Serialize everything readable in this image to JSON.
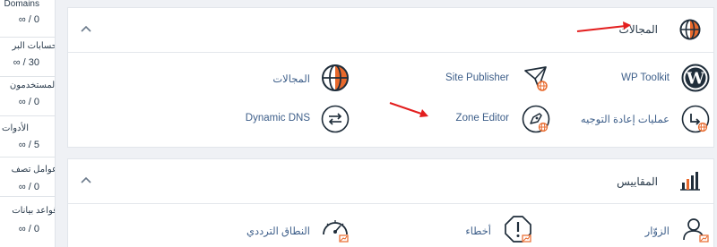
{
  "sidebar": {
    "stats": [
      {
        "label": "Domains",
        "value": "∞ / 0"
      },
      {
        "label": "حسابات البر",
        "value": "∞ / 30"
      },
      {
        "label": "المستخدمون",
        "value": "∞ / 0"
      },
      {
        "label": "الأدوات",
        "value": "∞ / 5"
      },
      {
        "label": "عوامل تصف",
        "value": "∞ / 0"
      },
      {
        "label": "قواعد بيانات",
        "value": "∞ / 0"
      }
    ]
  },
  "domains_panel": {
    "title": "المجالات",
    "items": [
      {
        "label": "WP Toolkit",
        "icon": "wordpress-icon"
      },
      {
        "label": "Site Publisher",
        "icon": "paper-plane-icon"
      },
      {
        "label": "المجالات",
        "icon": "globe-icon"
      },
      {
        "label": "عمليات إعادة التوجيه",
        "icon": "redirect-icon"
      },
      {
        "label": "Zone Editor",
        "icon": "zone-editor-icon"
      },
      {
        "label": "Dynamic DNS",
        "icon": "exchange-arrows-icon"
      }
    ]
  },
  "metrics_panel": {
    "title": "المقاييس",
    "items": [
      {
        "label": "الزوّار",
        "icon": "visitors-icon"
      },
      {
        "label": "أخطاء",
        "icon": "errors-icon"
      },
      {
        "label": "النطاق الترددي",
        "icon": "gauge-icon"
      }
    ]
  },
  "colors": {
    "accent_orange": "#e8692c",
    "link_blue": "#3e5f8a",
    "annotation_red": "#e31e1e",
    "icon_dark": "#1f2d3a"
  }
}
